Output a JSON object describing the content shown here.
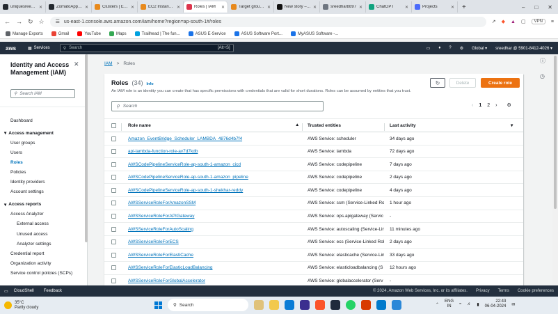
{
  "browser": {
    "tabs": [
      {
        "title": "uniquesreedhar",
        "color": "#24292f",
        "active": false
      },
      {
        "title": "ZomatoApp-CI",
        "color": "#24292f",
        "active": false
      },
      {
        "title": "Clusters | Elastic",
        "color": "#e8891b",
        "active": false
      },
      {
        "title": "EC2 Instance C",
        "color": "#e8891b",
        "active": false
      },
      {
        "title": "Roles | IAM",
        "color": "#dd344c",
        "active": true
      },
      {
        "title": "Target group d",
        "color": "#e8891b",
        "active": false
      },
      {
        "title": "New story – Me",
        "color": "#111111",
        "active": false
      },
      {
        "title": "sreedhar8897",
        "color": "#6e7681",
        "active": false
      },
      {
        "title": "ChatGPT",
        "color": "#10a37f",
        "active": false
      },
      {
        "title": "Projects",
        "color": "#4b6bfb",
        "active": false
      }
    ],
    "url": "us-east-1.console.aws.amazon.com/iam/home?region=ap-south-1#/roles",
    "vpn_label": "VPN",
    "bookmarks": [
      {
        "label": "Manage Exports",
        "color": "#5f6368"
      },
      {
        "label": "Gmail",
        "color": "#ea4335"
      },
      {
        "label": "YouTube",
        "color": "#ff0000"
      },
      {
        "label": "Maps",
        "color": "#34a853"
      },
      {
        "label": "Trailhead | The fun...",
        "color": "#00a1e0"
      },
      {
        "label": "ASUS E-Service",
        "color": "#1a73e8"
      },
      {
        "label": "ASUS Software Port...",
        "color": "#1a73e8"
      },
      {
        "label": "MyASUS Software -...",
        "color": "#1a73e8"
      }
    ]
  },
  "aws_nav": {
    "logo": "aws",
    "services": "Services",
    "search_placeholder": "Search",
    "shortcut": "[Alt+S]",
    "region": "Global ▾",
    "account": "sreedhar @ 5901-8412-4026 ▾"
  },
  "sidebar": {
    "title": "Identity and Access Management (IAM)",
    "search_placeholder": "Search IAM",
    "items": [
      {
        "label": "Dashboard",
        "kind": "plain"
      },
      {
        "label": "Access management",
        "kind": "sec"
      },
      {
        "label": "User groups",
        "kind": "plain"
      },
      {
        "label": "Users",
        "kind": "plain"
      },
      {
        "label": "Roles",
        "kind": "active"
      },
      {
        "label": "Policies",
        "kind": "plain"
      },
      {
        "label": "Identity providers",
        "kind": "plain"
      },
      {
        "label": "Account settings",
        "kind": "plain"
      },
      {
        "label": "Access reports",
        "kind": "sec"
      },
      {
        "label": "Access Analyzer",
        "kind": "plain"
      },
      {
        "label": "External access",
        "kind": "sub"
      },
      {
        "label": "Unused access",
        "kind": "sub"
      },
      {
        "label": "Analyzer settings",
        "kind": "sub"
      },
      {
        "label": "Credential report",
        "kind": "plain"
      },
      {
        "label": "Organization activity",
        "kind": "plain"
      },
      {
        "label": "Service control policies (SCPs)",
        "kind": "plain"
      }
    ]
  },
  "breadcrumb": {
    "root": "IAM",
    "sep": ">",
    "current": "Roles"
  },
  "roles": {
    "title": "Roles",
    "count": "(34)",
    "info": "Info",
    "description": "An IAM role is an identity you can create that has specific permissions with credentials that are valid for short durations. Roles can be assumed by entities that you trust.",
    "refresh_icon": "refresh-icon",
    "delete_label": "Delete",
    "create_label": "Create role",
    "search_placeholder": "Search",
    "pagination": {
      "page1": "1",
      "page2": "2"
    },
    "columns": {
      "name": "Role name",
      "trusted": "Trusted entities",
      "activity": "Last activity"
    },
    "rows": [
      {
        "name": "Amazon_EventBridge_Scheduler_LAMBDA_4876d4b7f4",
        "trusted": "AWS Service: scheduler",
        "activity": "34 days ago"
      },
      {
        "name": "api-lambda-function-role-av7d7kdb",
        "trusted": "AWS Service: lambda",
        "activity": "72 days ago"
      },
      {
        "name": "AWSCodePipelineServiceRole-ap-south-1-amazon_cicd",
        "trusted": "AWS Service: codepipeline",
        "activity": "7 days ago"
      },
      {
        "name": "AWSCodePipelineServiceRole-ap-south-1-amazon_pipeline",
        "trusted": "AWS Service: codepipeline",
        "activity": "2 days ago"
      },
      {
        "name": "AWSCodePipelineServiceRole-ap-south-1-shekhar-reddy",
        "trusted": "AWS Service: codepipeline",
        "activity": "4 days ago"
      },
      {
        "name": "AWSServiceRoleForAmazonSSM",
        "trusted": "AWS Service: ssm (Service-Linked Ro",
        "activity": "1 hour ago"
      },
      {
        "name": "AWSServiceRoleForAPIGateway",
        "trusted": "AWS Service: ops.apigateway (Servic",
        "activity": "-"
      },
      {
        "name": "AWSServiceRoleForAutoScaling",
        "trusted": "AWS Service: autoscaling (Service-Lin",
        "activity": "11 minutes ago"
      },
      {
        "name": "AWSServiceRoleForECS",
        "trusted": "AWS Service: ecs (Service-Linked Rol",
        "activity": "2 days ago"
      },
      {
        "name": "AWSServiceRoleForElastiCache",
        "trusted": "AWS Service: elasticache (Service-Lin",
        "activity": "33 days ago"
      },
      {
        "name": "AWSServiceRoleForElasticLoadBalancing",
        "trusted": "AWS Service: elasticloadbalancing (S",
        "activity": "12 hours ago"
      },
      {
        "name": "AWSServiceRoleForGlobalAccelerator",
        "trusted": "AWS Service: globalaccelerator (Serv",
        "activity": "-"
      }
    ]
  },
  "footer": {
    "cloudshell": "CloudShell",
    "feedback": "Feedback",
    "copyright": "© 2024, Amazon Web Services, Inc. or its affiliates.",
    "privacy": "Privacy",
    "terms": "Terms",
    "cookies": "Cookie preferences"
  },
  "taskbar": {
    "temp": "35°C",
    "weather": "Partly cloudy",
    "search": "Search",
    "lang1": "ENG",
    "lang2": "IN",
    "time": "22:43",
    "date": "06-04-2024"
  }
}
